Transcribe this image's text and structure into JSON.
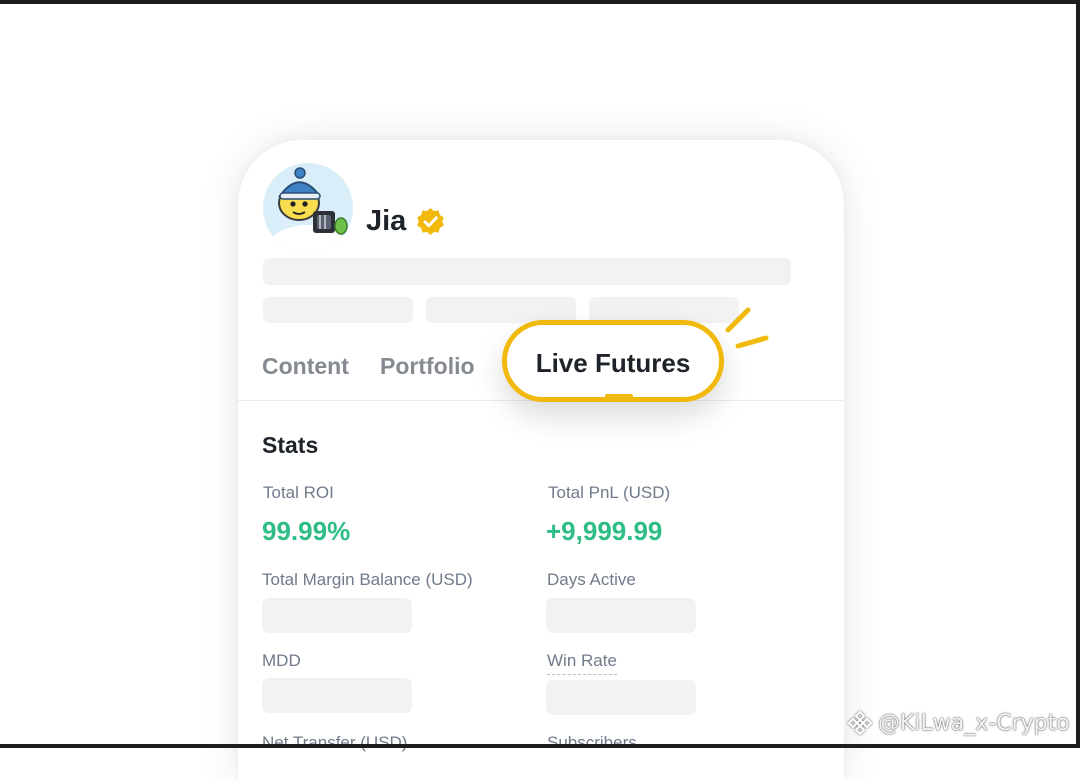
{
  "profile": {
    "name": "Jia",
    "verified": true
  },
  "tabs": [
    {
      "label": "Content"
    },
    {
      "label": "Portfolio"
    },
    {
      "label": "Live Futures",
      "active": true
    }
  ],
  "stats": {
    "title": "Stats",
    "items": [
      {
        "label": "Total ROI",
        "value": "99.99%"
      },
      {
        "label": "Total PnL (USD)",
        "value": "+9,999.99"
      },
      {
        "label": "Total Margin Balance (USD)",
        "value": ""
      },
      {
        "label": "Days Active",
        "value": ""
      },
      {
        "label": "MDD",
        "value": ""
      },
      {
        "label": "Win Rate",
        "value": ""
      },
      {
        "label": "Net Transfer (USD)",
        "value": ""
      },
      {
        "label": "Subscribers",
        "value": ""
      }
    ]
  },
  "watermark": {
    "text": "@KiLwa_x-Crypto"
  },
  "colors": {
    "accent": "#f0b90b",
    "positive": "#2ebd85",
    "text_primary": "#1e2329",
    "text_secondary": "#707a8a",
    "placeholder": "#f2f2f2"
  },
  "icons": {
    "verified": "verified-badge-icon",
    "watermark_logo": "binance-logo-icon"
  }
}
